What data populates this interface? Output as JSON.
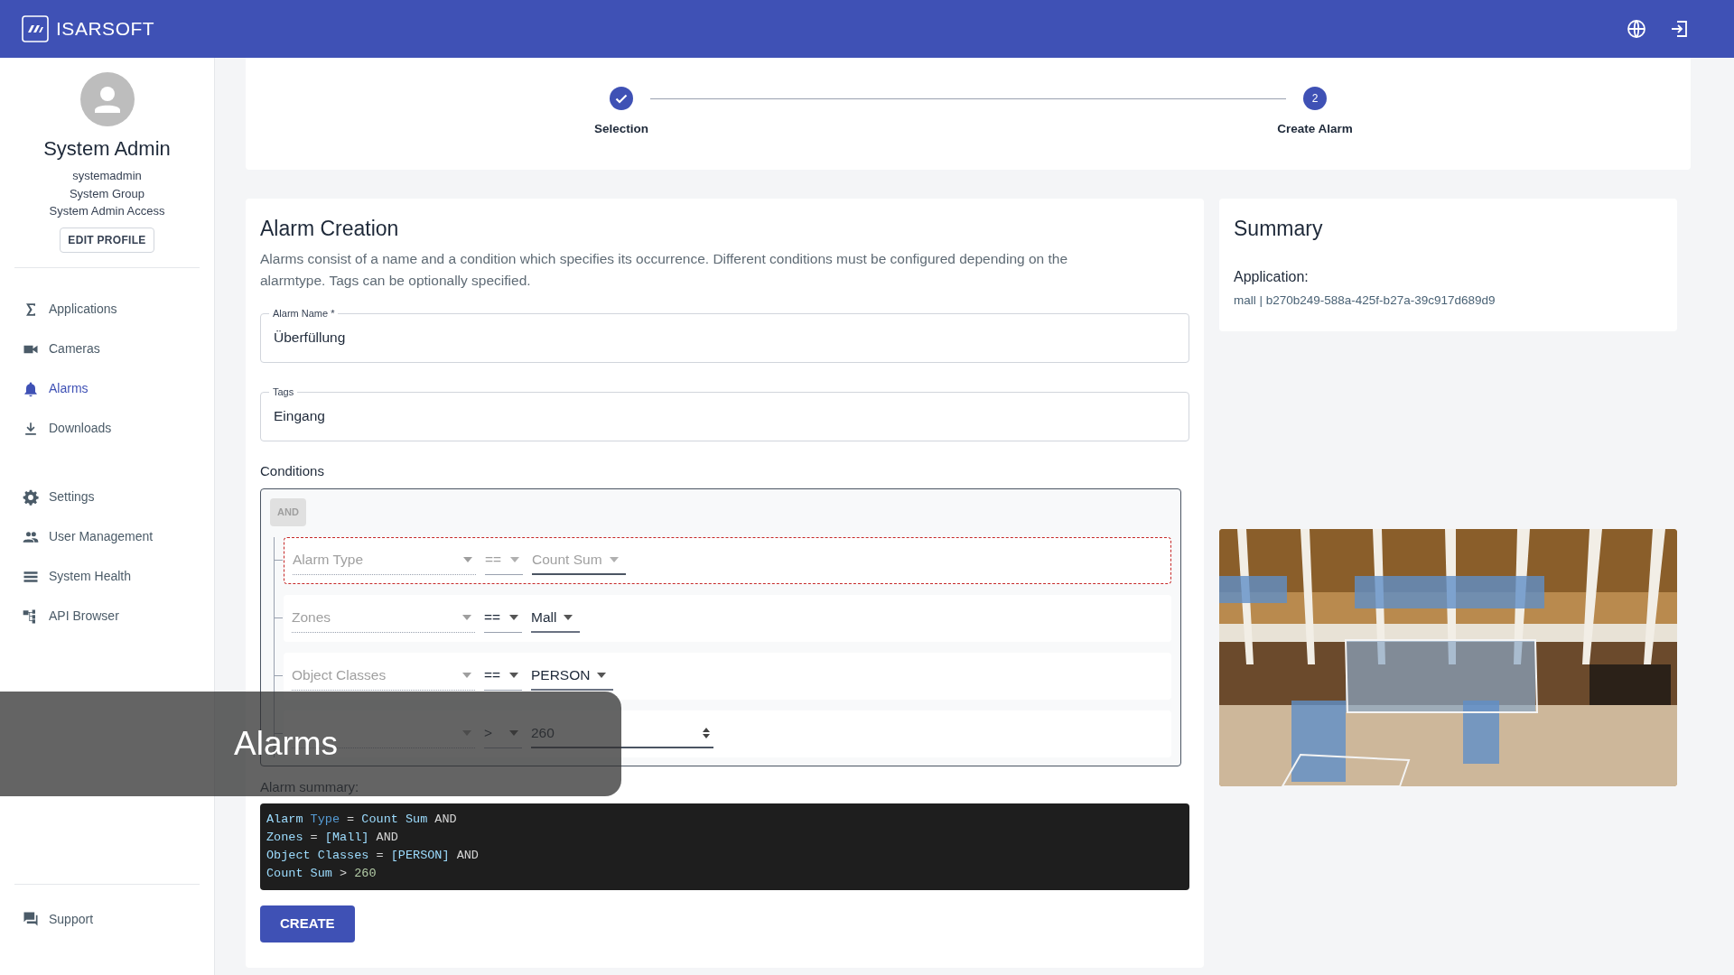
{
  "header": {
    "logo": "ISARSOFT"
  },
  "user": {
    "name": "System Admin",
    "username": "systemadmin",
    "group": "System Group",
    "access": "System Admin Access",
    "edit_button": "EDIT PROFILE"
  },
  "nav_main": [
    {
      "label": "Applications",
      "selected": false
    },
    {
      "label": "Cameras",
      "selected": false
    },
    {
      "label": "Alarms",
      "selected": true
    },
    {
      "label": "Downloads",
      "selected": false
    }
  ],
  "nav_admin": [
    {
      "label": "Settings",
      "selected": false
    },
    {
      "label": "User Management",
      "selected": false
    },
    {
      "label": "System Health",
      "selected": false
    },
    {
      "label": "API Browser",
      "selected": false
    }
  ],
  "nav_bottom": [
    {
      "label": "Support",
      "selected": false
    }
  ],
  "stepper": [
    {
      "label": "Selection",
      "kind": "done"
    },
    {
      "label": "Create Alarm",
      "kind": "active",
      "number": "2"
    }
  ],
  "form": {
    "title": "Alarm Creation",
    "description": "Alarms consist of a name and a condition which specifies its occurrence. Different conditions must be configured depending on the alarmtype. Tags can be optionally specified.",
    "fields": [
      {
        "label": "Alarm Name *",
        "value": "Überfüllung"
      },
      {
        "label": "Tags",
        "value": "Eingang"
      }
    ],
    "conditions_label": "Conditions",
    "combinator": "AND",
    "conditions": [
      {
        "kind": "select",
        "field": "Alarm Type",
        "operator": "==",
        "value": "Count Sum",
        "disabled": true,
        "invalid": true
      },
      {
        "kind": "select",
        "field": "Zones",
        "operator": "==",
        "value": "Mall",
        "disabled": false,
        "invalid": false
      },
      {
        "kind": "select",
        "field": "Object Classes",
        "operator": "==",
        "value": "PERSON",
        "disabled": false,
        "invalid": false
      },
      {
        "kind": "number",
        "operator": ">",
        "value": "260",
        "disabled": false,
        "invalid": false
      }
    ],
    "summary_label": "Alarm summary:",
    "summary_code": [
      [
        {
          "text": "Alarm ",
          "kind": "ident"
        },
        {
          "text": "Type",
          "kind": "keyword"
        },
        {
          "text": " = ",
          "kind": "op"
        },
        {
          "text": "Count Sum",
          "kind": "ident"
        },
        {
          "text": " AND",
          "kind": "op"
        }
      ],
      [
        {
          "text": "Zones",
          "kind": "ident"
        },
        {
          "text": " = ",
          "kind": "op"
        },
        {
          "text": "[Mall]",
          "kind": "ident"
        },
        {
          "text": " AND",
          "kind": "op"
        }
      ],
      [
        {
          "text": "Object Classes",
          "kind": "ident"
        },
        {
          "text": " = ",
          "kind": "op"
        },
        {
          "text": "[PERSON]",
          "kind": "ident"
        },
        {
          "text": " AND",
          "kind": "op"
        }
      ],
      [
        {
          "text": "Count Sum",
          "kind": "ident"
        },
        {
          "text": " > ",
          "kind": "op"
        },
        {
          "text": "260",
          "kind": "number"
        }
      ]
    ],
    "create_button": "CREATE"
  },
  "summary": {
    "title": "Summary",
    "application_label": "Application:",
    "application_value": "mall | b270b249-588a-425f-b27a-39c917d689d9"
  },
  "toast": {
    "text": "Alarms"
  }
}
